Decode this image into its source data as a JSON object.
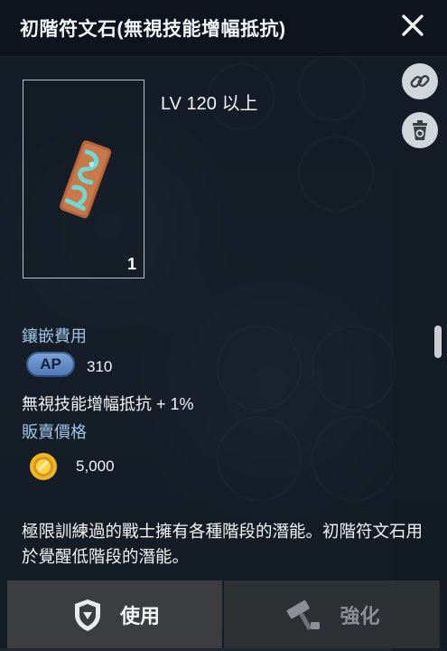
{
  "title": "初階符文石(無視技能增幅抵抗)",
  "item": {
    "level_requirement": "LV 120 以上",
    "count": "1"
  },
  "inlay_cost": {
    "label": "鑲嵌費用",
    "currency": "AP",
    "amount": "310"
  },
  "effect": "無視技能增幅抵抗  + 1%",
  "sell_price": {
    "label": "販賣價格",
    "amount": "5,000"
  },
  "description": "極限訓練過的戰士擁有各種階段的潛能。初階符文石用於覺醒低階段的潛能。",
  "buttons": {
    "use": "使用",
    "enhance": "強化"
  },
  "colors": {
    "label_blue": "#9fc4e6",
    "ap_badge": "#6a90c9",
    "gold": "#f0b623",
    "rune_teal": "#6fd6d0",
    "rune_rust": "#b8643c"
  }
}
